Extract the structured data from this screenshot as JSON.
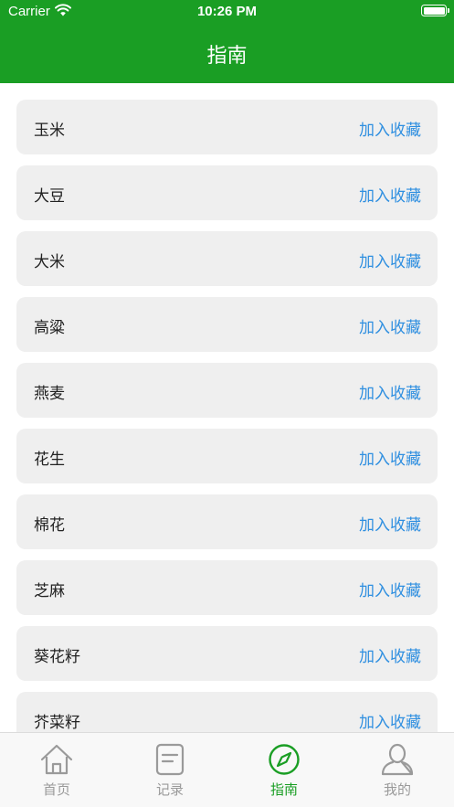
{
  "status_bar": {
    "carrier": "Carrier",
    "time": "10:26 PM"
  },
  "header": {
    "title": "指南"
  },
  "list": {
    "items": [
      {
        "name": "玉米",
        "action": "加入收藏"
      },
      {
        "name": "大豆",
        "action": "加入收藏"
      },
      {
        "name": "大米",
        "action": "加入收藏"
      },
      {
        "name": "高粱",
        "action": "加入收藏"
      },
      {
        "name": "燕麦",
        "action": "加入收藏"
      },
      {
        "name": "花生",
        "action": "加入收藏"
      },
      {
        "name": "棉花",
        "action": "加入收藏"
      },
      {
        "name": "芝麻",
        "action": "加入收藏"
      },
      {
        "name": "葵花籽",
        "action": "加入收藏"
      },
      {
        "name": "芥菜籽",
        "action": "加入收藏"
      }
    ]
  },
  "tabbar": {
    "tabs": [
      {
        "label": "首页",
        "icon": "home-icon",
        "active": false
      },
      {
        "label": "记录",
        "icon": "record-icon",
        "active": false
      },
      {
        "label": "指南",
        "icon": "compass-icon",
        "active": true
      },
      {
        "label": "我的",
        "icon": "user-icon",
        "active": false
      }
    ]
  },
  "colors": {
    "brand_green": "#1a9e24",
    "link_blue": "#2f8fe0",
    "row_bg": "#efefef",
    "tab_inactive": "#9a9a9a"
  }
}
